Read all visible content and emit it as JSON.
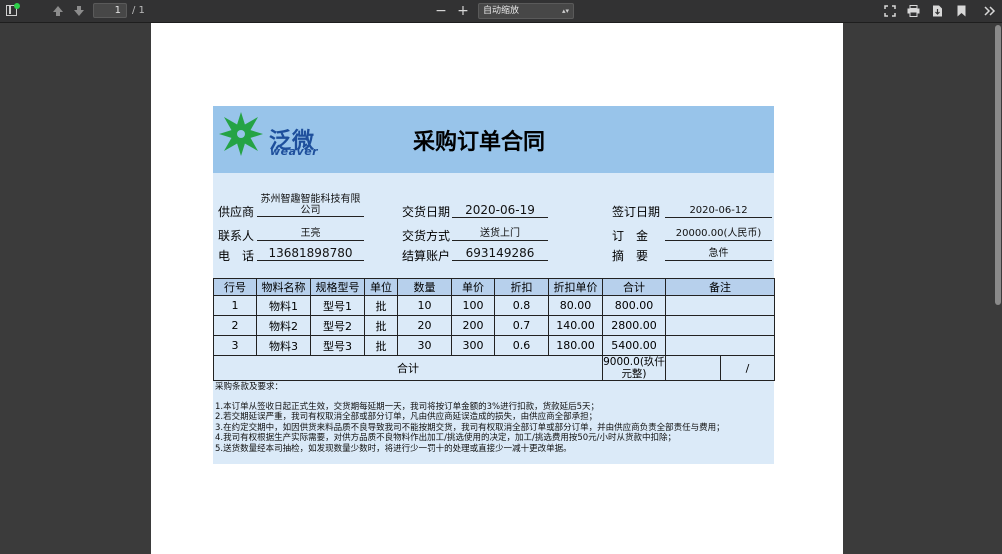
{
  "toolbar": {
    "page_current": "1",
    "page_total": "/ 1",
    "zoom_minus": "−",
    "zoom_plus": "+",
    "zoom_label": "自动缩放",
    "zoom_arrow": "▴▾"
  },
  "doc": {
    "logo_text": "泛微",
    "logo_sub": "weaver",
    "title": "采购订单合同",
    "info": {
      "supplier_label": "供应商",
      "supplier_value": "苏州智趣智能科技有限公司",
      "delivery_date_label": "交货日期",
      "delivery_date_value": "2020-06-19",
      "sign_date_label": "签订日期",
      "sign_date_value": "2020-06-12",
      "contact_label": "联系人",
      "contact_value": "王亮",
      "delivery_method_label": "交货方式",
      "delivery_method_value": "送货上门",
      "deposit_label": "订　金",
      "deposit_value": "20000.00(人民币)",
      "phone_label": "电　话",
      "phone_value": "13681898780",
      "account_label": "结算账户",
      "account_value": "693149286",
      "summary_label": "摘　要",
      "summary_value": "急件"
    },
    "table": {
      "headers": [
        "行号",
        "物料名称",
        "规格型号",
        "单位",
        "数量",
        "单价",
        "折扣",
        "折扣单价",
        "合计",
        "备注"
      ],
      "rows": [
        [
          "1",
          "物料1",
          "型号1",
          "批",
          "10",
          "100",
          "0.8",
          "80.00",
          "800.00",
          ""
        ],
        [
          "2",
          "物料2",
          "型号2",
          "批",
          "20",
          "200",
          "0.7",
          "140.00",
          "2800.00",
          ""
        ],
        [
          "3",
          "物料3",
          "型号3",
          "批",
          "30",
          "300",
          "0.6",
          "180.00",
          "5400.00",
          ""
        ]
      ],
      "total_label": "合计",
      "total_value": "9000.0(玖仟元整)",
      "total_extra": "/"
    },
    "terms": {
      "heading": "采购条款及要求：",
      "items": [
        "1.本订单从签收日起正式生效，交货期每延期一天，我司将按订单金额的3%进行扣款，货款延后5天；",
        "2.若交期延误严重，我司有权取消全部或部分订单，凡由供应商延误造成的损失，由供应商全部承担；",
        "3.在约定交期中，如因供货来料品质不良导致我司不能按期交货，我司有权取消全部订单或部分订单，并由供应商负责全部责任与费用；",
        "4.我司有权根据生产实际需要，对供方品质不良物料作出加工/挑选使用的决定，加工/挑选费用按50元/小时从货款中扣除；",
        "5.送货数量经本司抽检，如发现数量少数时，将进行少一罚十的处理或直接少一减十更改单据。"
      ]
    }
  }
}
